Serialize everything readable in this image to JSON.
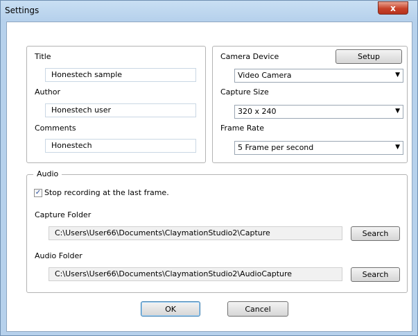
{
  "window": {
    "title": "Settings",
    "close_glyph": "x"
  },
  "info": {
    "title_label": "Title",
    "title_value": "Honestech sample",
    "author_label": "Author",
    "author_value": "Honestech user",
    "comments_label": "Comments",
    "comments_value": "Honestech"
  },
  "camera": {
    "device_label": "Camera Device",
    "setup_button": "Setup",
    "device_value": "Video Camera",
    "capture_size_label": "Capture Size",
    "capture_size_value": "320 x 240",
    "frame_rate_label": "Frame Rate",
    "frame_rate_value": "5 Frame per second"
  },
  "audio": {
    "group_title": "Audio",
    "stop_recording_label": "Stop recording at the last frame.",
    "stop_recording_checked": true,
    "capture_folder_label": "Capture Folder",
    "capture_folder_value": "C:\\Users\\User66\\Documents\\ClaymationStudio2\\Capture",
    "capture_search_button": "Search",
    "audio_folder_label": "Audio Folder",
    "audio_folder_value": "C:\\Users\\User66\\Documents\\ClaymationStudio2\\AudioCapture",
    "audio_search_button": "Search"
  },
  "footer": {
    "ok_button": "OK",
    "cancel_button": "Cancel"
  }
}
